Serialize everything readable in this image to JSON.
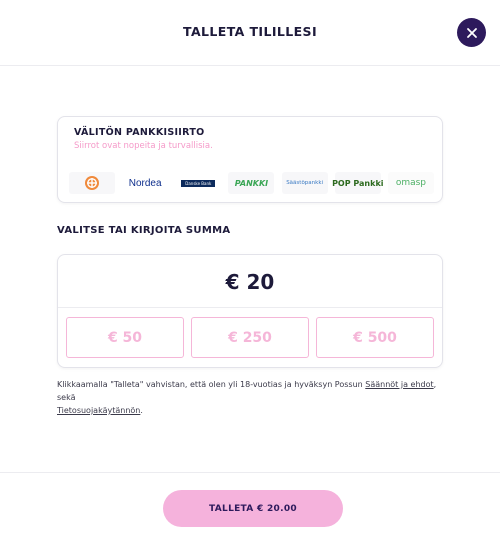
{
  "header": {
    "title": "TALLETA TILILLESI",
    "close_icon": "close-icon"
  },
  "bank_transfer": {
    "title": "VÄLITÖN PANKKISIIRTO",
    "subtitle": "Siirrot ovat nopeita ja turvallisia.",
    "banks": [
      {
        "name": "aktia",
        "label": "",
        "icon": "aktia-logo"
      },
      {
        "name": "nordea",
        "label": "Nordea"
      },
      {
        "name": "danske",
        "label": "Danske Bank"
      },
      {
        "name": "spankki",
        "label": "PANKKI"
      },
      {
        "name": "saastopankki",
        "label": "Säästöpankki"
      },
      {
        "name": "pop-pankki",
        "label": "POP Pankki"
      },
      {
        "name": "omasp",
        "label": "omasp"
      }
    ]
  },
  "amount_section": {
    "title": "VALITSE TAI KIRJOITA SUMMA",
    "input_value": "€ 20",
    "presets": [
      "€ 50",
      "€ 250",
      "€ 500"
    ]
  },
  "disclaimer": {
    "text_before": "Klikkaamalla \"Talleta\" vahvistan, että olen yli 18-vuotias ja hyväksyn Possun ",
    "terms_link": "Säännöt ja ehdot",
    "text_middle": ", sekä ",
    "privacy_link": "Tietosuojakäytännön",
    "text_after": "."
  },
  "footer": {
    "deposit_label": "TALLETA € 20.00"
  },
  "colors": {
    "accent_pink": "#f5b2dc",
    "primary_dark": "#2d1a5c",
    "subtitle_pink": "#f59ac9"
  }
}
